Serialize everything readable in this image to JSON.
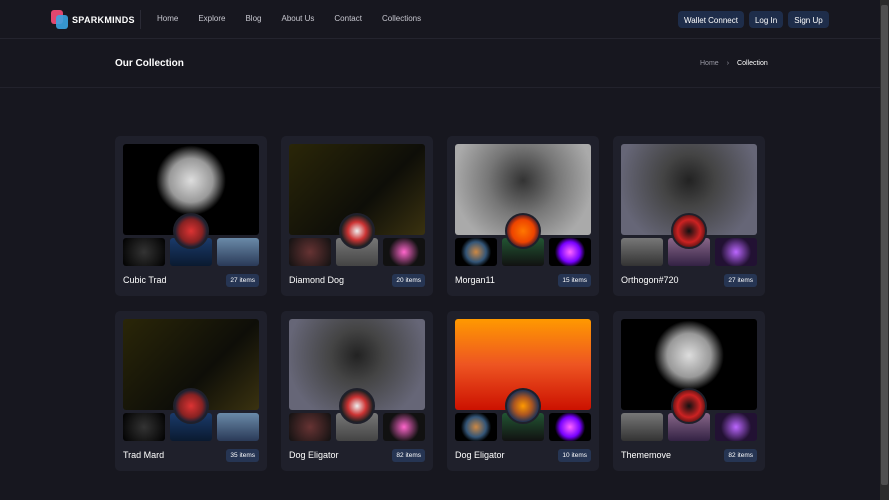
{
  "brand": "SPARKMINDS",
  "nav": [
    "Home",
    "Explore",
    "Blog",
    "About Us",
    "Contact",
    "Collections"
  ],
  "buttons": {
    "wallet": "Wallet Connect",
    "login": "Log In",
    "signup": "Sign Up"
  },
  "page_title": "Our Collection",
  "breadcrumb": {
    "home": "Home",
    "sep": "›",
    "current": "Collection"
  },
  "collections": [
    {
      "name": "Cubic Trad",
      "items": "27 items",
      "main": "radial-gradient(circle at 50% 40%,#ddd 0,#999 25%,#000 40%)",
      "avatar": "radial-gradient(circle,#d33 0,#822 50%,#223 70%)",
      "thumbs": [
        "radial-gradient(circle,#333,#000)",
        "linear-gradient(#1a3a6a,#0a1a30)",
        "linear-gradient(#6a8aa8,#2a3a58)"
      ]
    },
    {
      "name": "Diamond Dog",
      "items": "20 items",
      "main": "linear-gradient(135deg,#2a2608,#0e0e08 60%,#3a3210)",
      "avatar": "radial-gradient(circle,#eee 0,#c33 40%,#222 70%)",
      "thumbs": [
        "radial-gradient(circle,#633,#111)",
        "linear-gradient(#777,#444)",
        "radial-gradient(circle,#f6c,#111 60%)"
      ]
    },
    {
      "name": "Morgan11",
      "items": "15 items",
      "main": "radial-gradient(circle at 50% 40%,#333 0,#777 40%,#aaa 80%)",
      "avatar": "radial-gradient(circle,#f70 0,#e40 50%,#213 80%)",
      "thumbs": [
        "radial-gradient(circle,#c84 0,#357 40%,#000 60%)",
        "linear-gradient(#253,#111)",
        "radial-gradient(circle,#f6f 0,#70f 40%,#000 60%)"
      ]
    },
    {
      "name": "Orthogon#720",
      "items": "27 items",
      "main": "radial-gradient(circle at 50% 40%,#222 0,#444 30%,#667 80%)",
      "avatar": "radial-gradient(circle,#111 0,#c22 50%,#411 80%)",
      "thumbs": [
        "linear-gradient(#777,#333)",
        "linear-gradient(#868,#324)",
        "radial-gradient(circle,#b6f,#213 60%)"
      ]
    },
    {
      "name": "Trad Mard",
      "items": "35 items",
      "main": "linear-gradient(135deg,#2a2608,#0e0e08 60%,#3a3210)",
      "avatar": "radial-gradient(circle,#d33 0,#822 50%,#223 70%)",
      "thumbs": [
        "radial-gradient(circle,#333,#000)",
        "linear-gradient(#1a3a6a,#0a1a30)",
        "linear-gradient(#6a8aa8,#2a3a58)"
      ]
    },
    {
      "name": "Dog Eligator",
      "items": "82 items",
      "main": "radial-gradient(circle at 50% 40%,#222 0,#444 30%,#667 80%)",
      "avatar": "radial-gradient(circle,#eee 0,#c33 40%,#222 70%)",
      "thumbs": [
        "radial-gradient(circle,#633,#111)",
        "linear-gradient(#777,#444)",
        "radial-gradient(circle,#f6c,#111 60%)"
      ]
    },
    {
      "name": "Dog Eligator",
      "items": "10 items",
      "main": "linear-gradient(#f90,#e52 50%,#c10)",
      "avatar": "radial-gradient(circle,#f90 0,#a52 40%,#235 70%)",
      "thumbs": [
        "radial-gradient(circle,#c84 0,#357 40%,#000 60%)",
        "linear-gradient(#253,#111)",
        "radial-gradient(circle,#f6f 0,#70f 40%,#000 60%)"
      ]
    },
    {
      "name": "Thememove",
      "items": "82 items",
      "main": "radial-gradient(circle at 50% 40%,#ddd 0,#999 25%,#000 40%)",
      "avatar": "radial-gradient(circle,#111 0,#c22 50%,#411 80%)",
      "thumbs": [
        "linear-gradient(#777,#333)",
        "linear-gradient(#868,#324)",
        "radial-gradient(circle,#b6f,#213 60%)"
      ]
    }
  ]
}
